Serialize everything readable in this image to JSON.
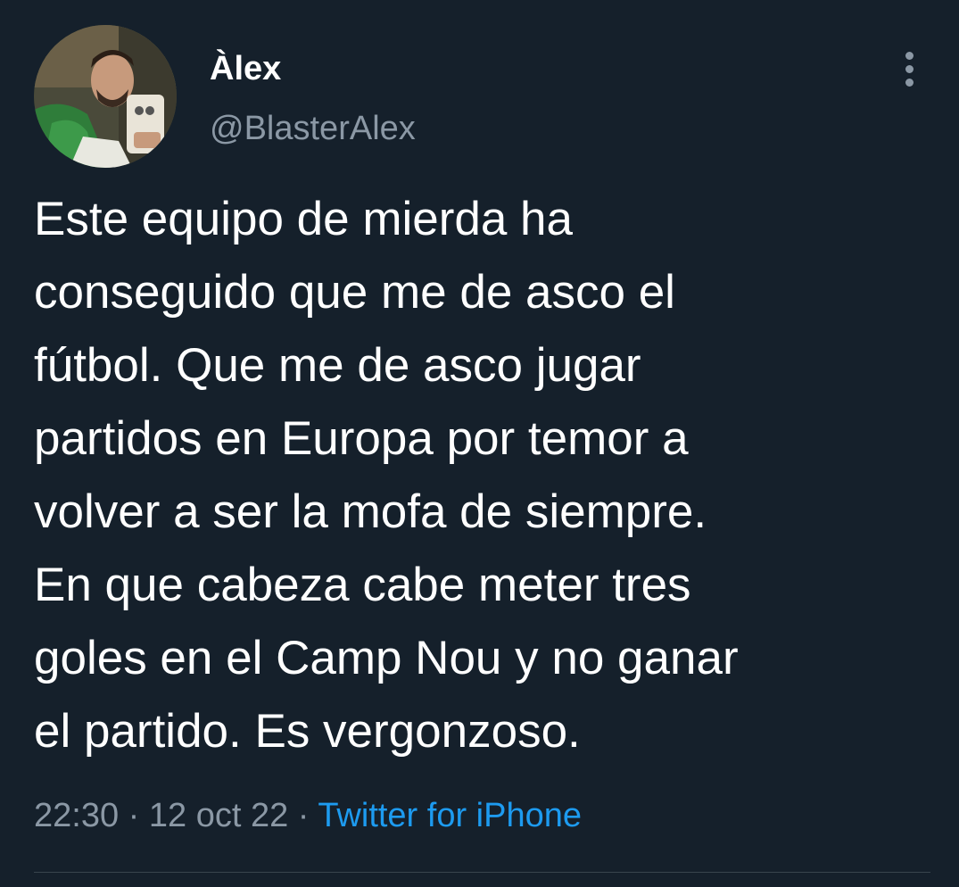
{
  "user": {
    "display_name": "Àlex",
    "handle": "@BlasterAlex",
    "avatar_icon": "avatar-photo"
  },
  "tweet": {
    "text": "Este equipo de mierda ha\nconseguido que me de asco el\nfútbol. Que me de asco jugar\npartidos en Europa por temor a\nvolver a ser la mofa de siempre.\nEn que cabeza cabe meter tres\ngoles en el Camp Nou y no ganar\nel partido. Es vergonzoso."
  },
  "meta": {
    "time": "22:30",
    "sep1": " · ",
    "date": "12 oct 22",
    "sep2": " · ",
    "source": "Twitter for iPhone"
  },
  "icons": {
    "more": "more-options-icon"
  },
  "colors": {
    "background": "#15202b",
    "secondary_text": "#8b98a5",
    "link": "#1d9bf0",
    "divider": "#38444d"
  }
}
